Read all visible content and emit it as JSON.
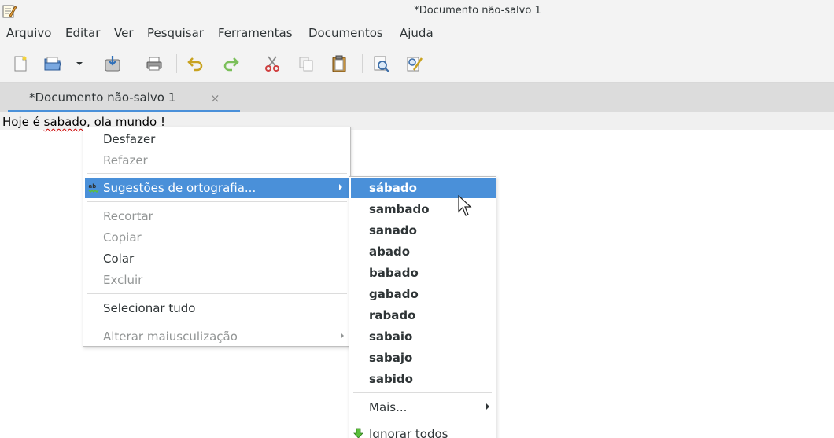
{
  "window": {
    "title": "*Documento não-salvo 1",
    "icon": "text-editor-icon"
  },
  "menubar": {
    "items": [
      "Arquivo",
      "Editar",
      "Ver",
      "Pesquisar",
      "Ferramentas",
      "Documentos",
      "Ajuda"
    ]
  },
  "toolbar": {
    "buttons": [
      "new-document-icon",
      "open-folder-icon",
      "dropdown-arrow-icon",
      "save-icon",
      "print-icon",
      "undo-icon",
      "redo-icon",
      "cut-icon",
      "copy-icon",
      "paste-icon",
      "find-icon",
      "find-replace-icon"
    ]
  },
  "tab": {
    "label": "*Documento não-salvo 1",
    "close": "×"
  },
  "editor": {
    "text_before": "Hoje é ",
    "misspelled_word": "sabado",
    "text_after": ", ola mundo !"
  },
  "context_menu": {
    "undo": "Desfazer",
    "redo": "Refazer",
    "spelling": "Sugestões de ortografia...",
    "cut": "Recortar",
    "copy": "Copiar",
    "paste": "Colar",
    "delete": "Excluir",
    "select_all": "Selecionar tudo",
    "change_case": "Alterar maiusculização"
  },
  "spelling_submenu": {
    "suggestions": [
      "sábado",
      "sambado",
      "sanado",
      "abado",
      "babado",
      "gabado",
      "rabado",
      "sabaio",
      "sabajo",
      "sabido"
    ],
    "more": "Mais...",
    "ignore_all": "Ignorar todos"
  },
  "colors": {
    "highlight": "#4a90d9",
    "menu_bg": "#ffffff",
    "chrome_bg": "#f3f3f3",
    "tab_bg": "#dcdcdc",
    "disabled_text": "#929595",
    "misspell_underline": "#cc0000"
  }
}
